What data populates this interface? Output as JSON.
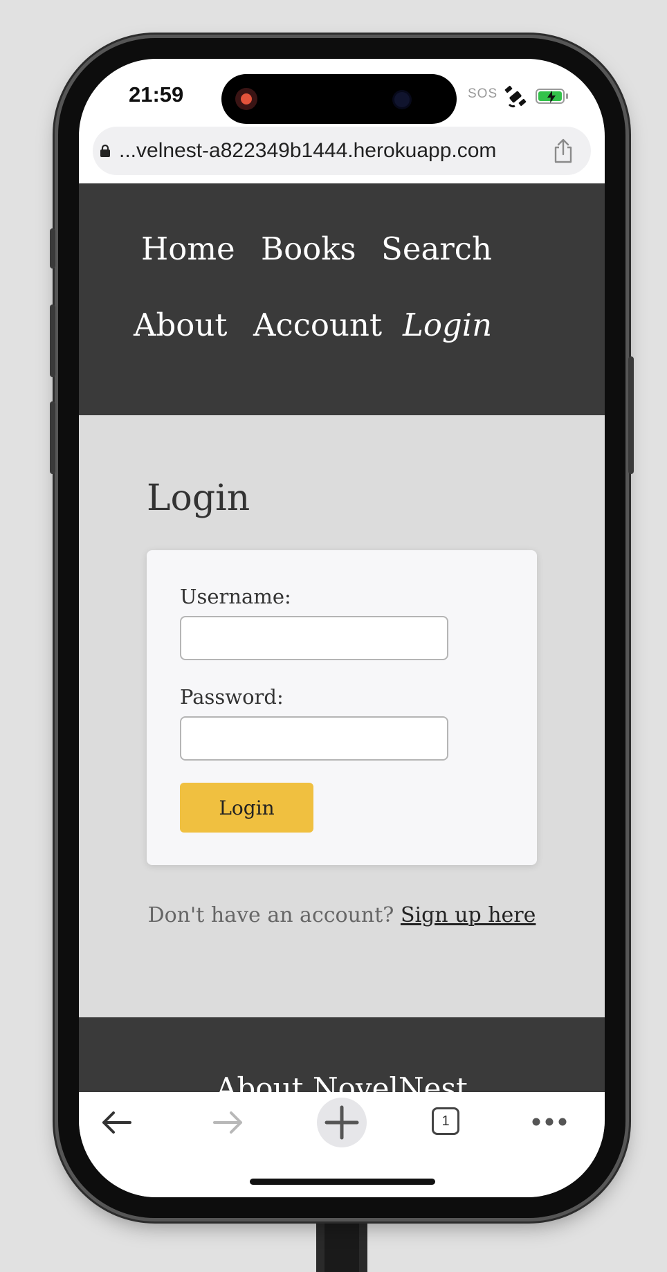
{
  "status_bar": {
    "time": "21:59",
    "sos": "SOS",
    "icons": [
      "screen-record-icon",
      "satellite-icon",
      "battery-charging-icon"
    ]
  },
  "browser": {
    "url": "...velnest-a822349b1444.herokuapp.com",
    "tabs_count": "1"
  },
  "nav": {
    "items": [
      {
        "label": "Home"
      },
      {
        "label": "Books"
      },
      {
        "label": "Search"
      },
      {
        "label": "About"
      },
      {
        "label": "Account"
      },
      {
        "label": "Login",
        "active": true
      }
    ]
  },
  "main": {
    "title": "Login",
    "form": {
      "username_label": "Username:",
      "username_value": "",
      "password_label": "Password:",
      "password_value": "",
      "submit_label": "Login"
    },
    "signup_prompt": "Don't have an account? ",
    "signup_link": "Sign up here"
  },
  "footer": {
    "title": "About NovelNest"
  },
  "colors": {
    "nav_bg": "#3a3a3a",
    "content_bg": "#dcdcdc",
    "button": "#f0c040",
    "battery": "#33c24a"
  }
}
